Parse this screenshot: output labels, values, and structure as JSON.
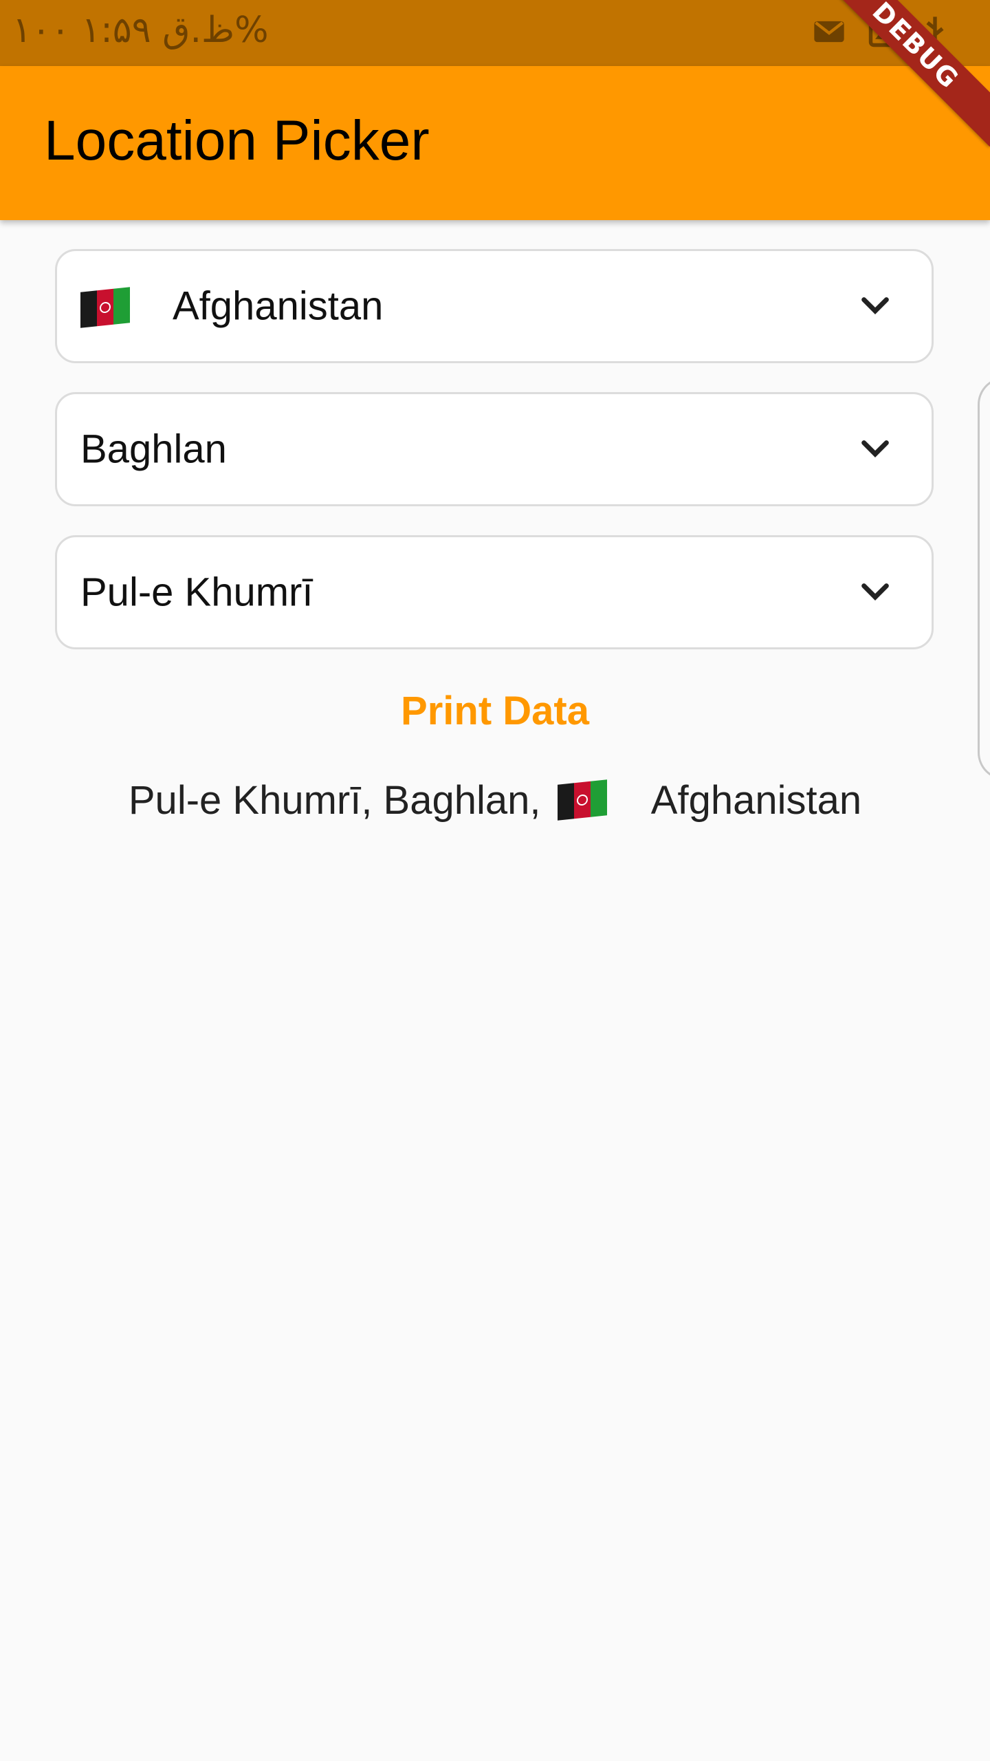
{
  "status_bar": {
    "text": "ظ.ق ۱:۵۹  ۱۰۰%",
    "icons": [
      "battery-icon",
      "signal-icon",
      "mail-icon",
      "image-icon",
      "usb-icon"
    ]
  },
  "app_bar": {
    "title": "Location Picker",
    "color": "#ff9800",
    "debug_label": "DEBUG"
  },
  "country_dropdown": {
    "value": "Afghanistan",
    "flag": "afghanistan-flag"
  },
  "state_dropdown": {
    "value": "Baghlan"
  },
  "city_dropdown": {
    "value": "Pul-e Khumrī"
  },
  "print_button": {
    "label": "Print Data",
    "color": "#ff9800"
  },
  "result": {
    "prefix": "Pul-e Khumrī, Baghlan,",
    "country": "Afghanistan"
  }
}
